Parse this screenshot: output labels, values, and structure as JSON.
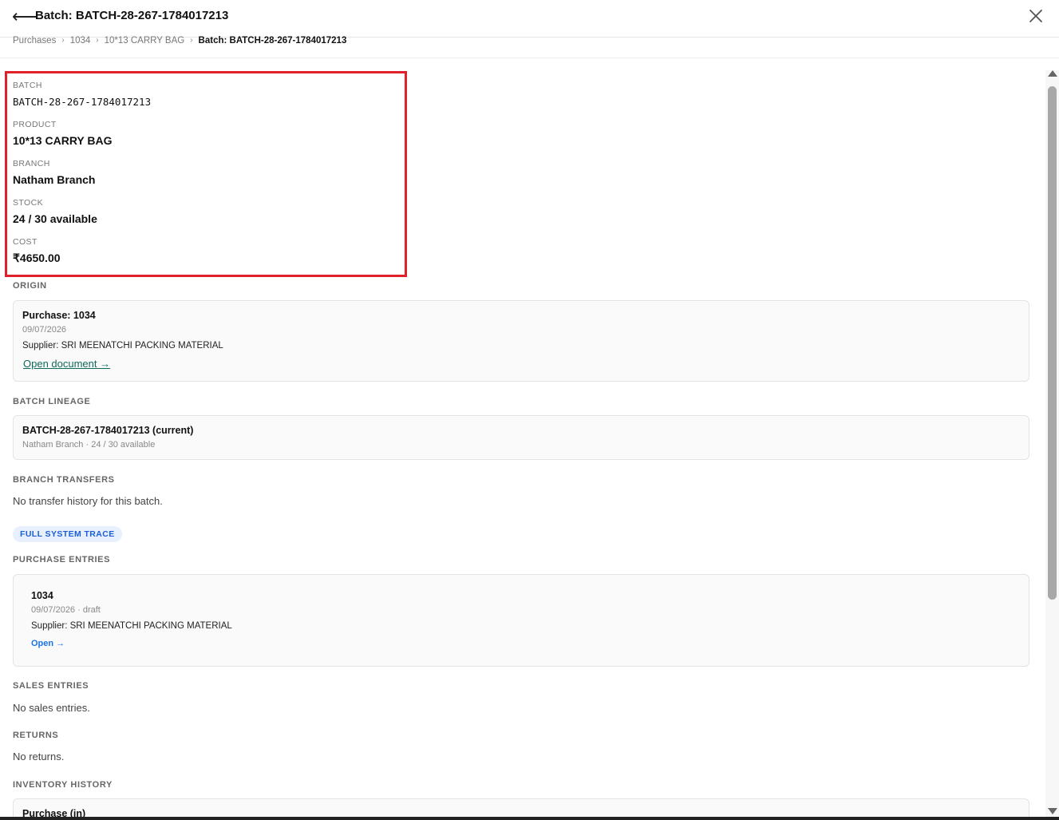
{
  "header": {
    "back_icon": "arrow-left-icon",
    "title": "Batch: BATCH-28-267-1784017213",
    "close_icon": "close-icon"
  },
  "breadcrumb": {
    "items": [
      "Purchases",
      "1034",
      "10*13 CARRY BAG",
      "Batch: BATCH-28-267-1784017213"
    ],
    "separator": "›"
  },
  "details": {
    "batch_label": "BATCH",
    "batch_value": "BATCH-28-267-1784017213",
    "product_label": "PRODUCT",
    "product_value": "10*13 CARRY BAG",
    "branch_label": "BRANCH",
    "branch_value": "Natham Branch",
    "stock_label": "STOCK",
    "stock_value": "24 / 30 available",
    "cost_label": "COST",
    "cost_value": "₹4650.00"
  },
  "origin": {
    "section_title": "ORIGIN",
    "title": "Purchase: 1034",
    "date": "09/07/2026",
    "supplier": "Supplier: SRI MEENATCHI PACKING MATERIAL",
    "link": "Open document →"
  },
  "lineage": {
    "section_title": "BATCH LINEAGE",
    "title": "BATCH-28-267-1784017213 (current)",
    "sub": "Natham Branch · 24 / 30 available"
  },
  "transfers": {
    "section_title": "BRANCH TRANSFERS",
    "empty": "No transfer history for this batch."
  },
  "trace_badge": "FULL SYSTEM TRACE",
  "purchase_entries": {
    "section_title": "PURCHASE ENTRIES",
    "title": "1034",
    "sub": "09/07/2026 · draft",
    "supplier": "Supplier: SRI MEENATCHI PACKING MATERIAL",
    "link": "Open →"
  },
  "sales_entries": {
    "section_title": "SALES ENTRIES",
    "empty": "No sales entries."
  },
  "returns": {
    "section_title": "RETURNS",
    "empty": "No returns."
  },
  "inventory_history": {
    "section_title": "INVENTORY HISTORY",
    "first_item": "Purchase (in)"
  },
  "colors": {
    "highlight": "#e0202a",
    "link_green": "#0f6b5c",
    "link_blue": "#1a73e8",
    "badge_bg": "#e8f0fe"
  }
}
